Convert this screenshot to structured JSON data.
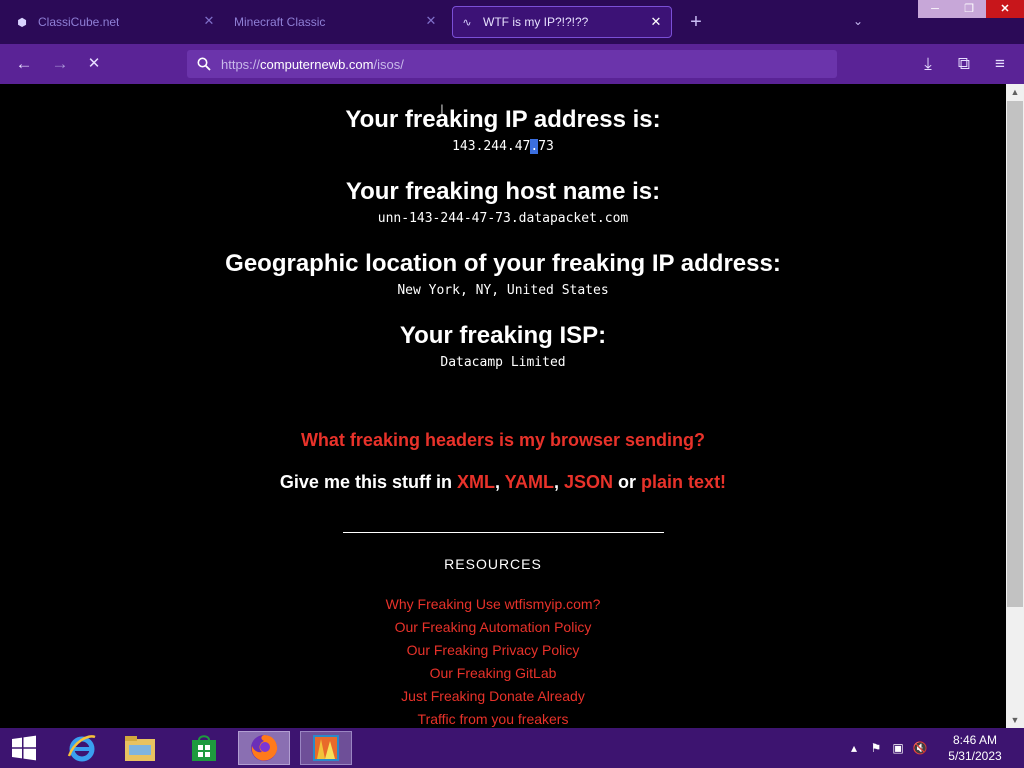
{
  "browser": {
    "tabs": [
      {
        "label": "ClassiCube.net",
        "icon": "cube-icon",
        "active": false
      },
      {
        "label": "Minecraft Classic",
        "icon": "",
        "active": false
      },
      {
        "label": "WTF is my IP?!?!??",
        "icon": "loading-icon",
        "active": true
      }
    ],
    "url": {
      "prefix": "https://",
      "host": "computernewb.com",
      "path": "/isos/"
    },
    "colors": {
      "tabbar": "#2b0a57",
      "navbar": "#5a2396",
      "urlbar": "#6b34ab",
      "close": "#c8161b"
    }
  },
  "page": {
    "ip_heading": "Your freaking IP address is:",
    "ip_part1": "143.244.47",
    "ip_selected": ".",
    "ip_part2": "73",
    "host_heading": "Your freaking host name is:",
    "host_value": "unn-143-244-47-73.datapacket.com",
    "geo_heading": "Geographic location of your freaking IP address:",
    "geo_value": "New York, NY, United States",
    "isp_heading": "Your freaking ISP:",
    "isp_value": "Datacamp Limited",
    "headers_link": "What freaking headers is my browser sending?",
    "give_me_prefix": "Give me this stuff in ",
    "formats": [
      "XML",
      "YAML",
      "JSON"
    ],
    "format_sep": ", ",
    "format_or": " or ",
    "format_last": "plain text!",
    "resources_heading": "RESOURCES",
    "resources_links": [
      "Why Freaking Use wtfismyip.com?",
      "Our Freaking Automation Policy",
      "Our Freaking Privacy Policy",
      "Our Freaking GitLab",
      "Just Freaking Donate Already",
      "Traffic from you freakers"
    ],
    "link_color": "#e8322a"
  },
  "taskbar": {
    "apps": [
      "start-icon",
      "internet-explorer-icon",
      "file-explorer-icon",
      "store-icon",
      "firefox-icon",
      "app-icon"
    ],
    "time": "8:46 AM",
    "date": "5/31/2023"
  }
}
